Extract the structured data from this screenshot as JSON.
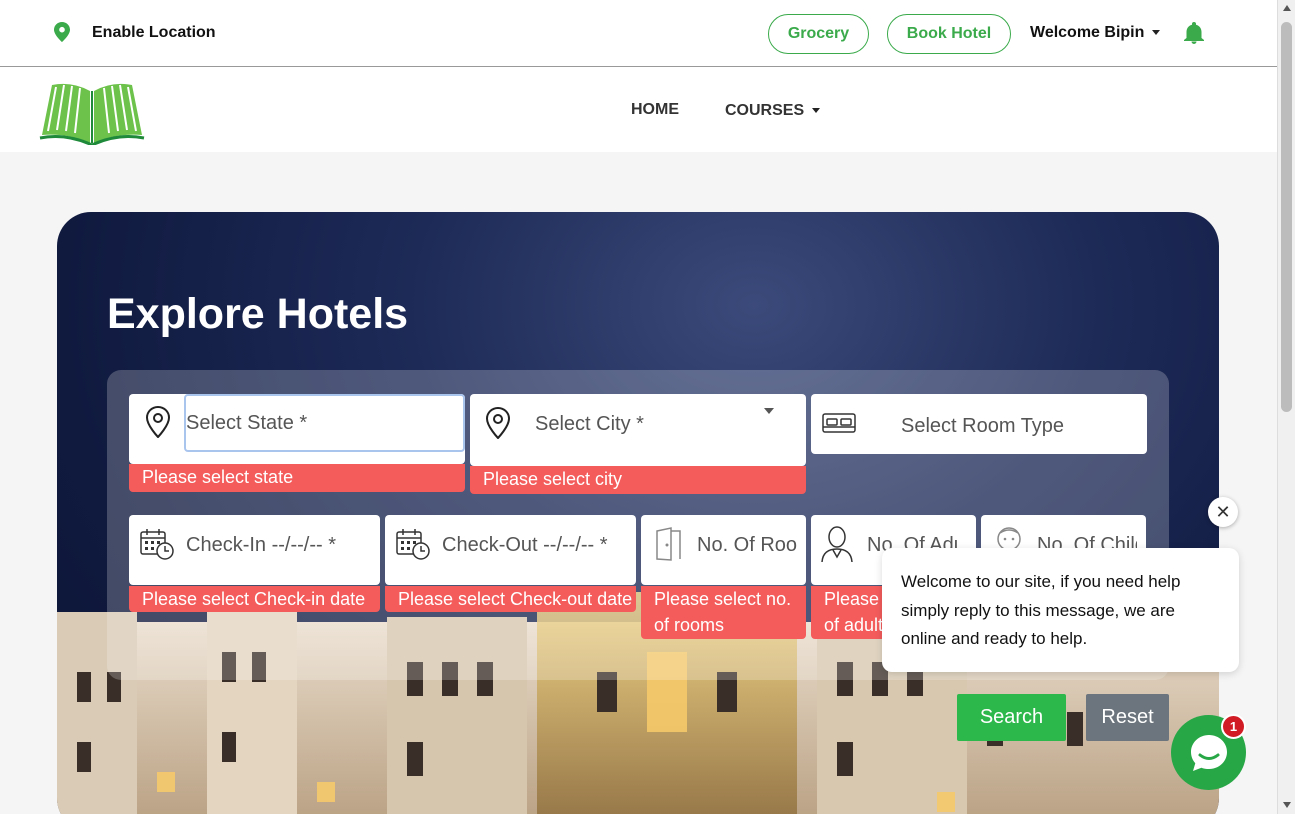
{
  "topbar": {
    "location_label": "Enable Location",
    "grocery_label": "Grocery",
    "book_hotel_label": "Book Hotel",
    "welcome_label": "Welcome Bipin"
  },
  "nav": {
    "home_label": "HOME",
    "courses_label": "COURSES"
  },
  "hero": {
    "title": "Explore Hotels"
  },
  "form": {
    "state_placeholder": "Select State *",
    "state_error": "Please select state",
    "city_placeholder": "Select City *",
    "city_error": "Please select city",
    "room_type_placeholder": "Select Room Type",
    "checkin_placeholder": "Check-In --/--/-- *",
    "checkin_error": "Please select Check-in date",
    "checkout_placeholder": "Check-Out --/--/-- *",
    "checkout_error": "Please select Check-out date",
    "rooms_placeholder": "No. Of Rooms",
    "rooms_error_line1": "Please select no.",
    "rooms_error_line2": "of rooms",
    "adults_placeholder": "No. Of Adults",
    "adults_error_line1": "Please select no.",
    "adults_error_line2": "of adults",
    "children_placeholder": "No. Of Children",
    "search_label": "Search",
    "reset_label": "Reset"
  },
  "chat": {
    "message": "Welcome to our site, if you need help simply reply to this message, we are online and ready to help.",
    "close_symbol": "✕",
    "badge_count": "1"
  },
  "colors": {
    "brand_green": "#3aaa4a",
    "error_red": "#f45c5c",
    "search_green": "#2db84b",
    "reset_gray": "#6c757d",
    "hero_navy": "#101a3f"
  },
  "icons": [
    "location-pin-icon",
    "bell-icon",
    "book-logo-icon",
    "map-pin-icon",
    "bed-icon",
    "calendar-clock-icon",
    "door-icon",
    "person-icon",
    "child-icon",
    "chat-icon",
    "close-icon"
  ]
}
